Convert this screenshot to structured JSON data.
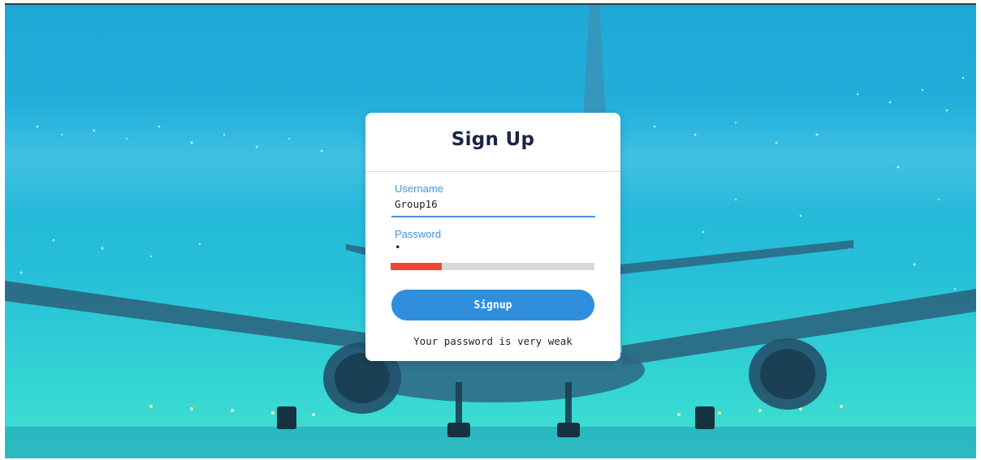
{
  "form": {
    "title": "Sign Up",
    "username": {
      "label": "Username",
      "value": "Group16"
    },
    "password": {
      "label": "Password",
      "value": "•",
      "strength_fraction": 0.25,
      "strength_color": "#f0453a"
    },
    "submit_label": "Signup",
    "status_message": "Your password is very weak"
  },
  "colors": {
    "accent": "#2f8fdc",
    "title": "#1b2347",
    "label": "#4a90d6"
  }
}
